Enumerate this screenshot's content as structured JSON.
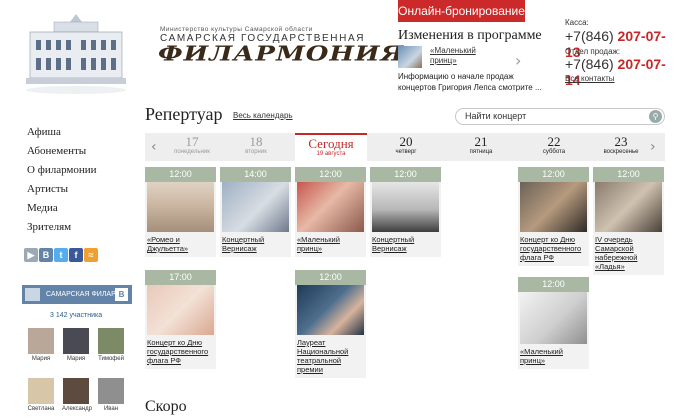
{
  "header": {
    "ministry": "Министерство культуры Самарской области",
    "org_line1": "САМАРСКАЯ ГОСУДАРСТВЕННАЯ",
    "org_line2": "ФИЛАРМОНИЯ",
    "booking_button": "Онлайн-бронирование",
    "changes_title": "Изменения в программе",
    "changes_link": "«Маленький принц»",
    "changes_text": "Информацию о начале продаж концертов Григория Лепса смотрите ...",
    "box_office_label": "Касса:",
    "box_office_code": "+7(846)",
    "box_office_number": "207-07-13",
    "sales_label": "Отдел продаж:",
    "sales_code": "+7(846)",
    "sales_number": "207-07-14",
    "all_contacts": "Все контакты"
  },
  "nav": {
    "items": [
      "Афиша",
      "Абонементы",
      "О филармонии",
      "Артисты",
      "Медиа",
      "Зрителям"
    ]
  },
  "vk": {
    "group_name": "САМАРСКАЯ ФИЛАР...",
    "vk_logo": "В",
    "members": "3 142 участника",
    "people": [
      "Мария",
      "Мария",
      "Тимофей",
      "Светлана",
      "Александр",
      "Иван"
    ]
  },
  "repertoire": {
    "title": "Репертуар",
    "all_calendar": "Весь календарь",
    "search_placeholder": "Найти концерт",
    "days": [
      {
        "d": "17",
        "w": "понедельник"
      },
      {
        "d": "18",
        "w": "вторник"
      },
      {
        "d": "Сегодня",
        "w": "19 августа"
      },
      {
        "d": "20",
        "w": "четверг"
      },
      {
        "d": "21",
        "w": "пятница"
      },
      {
        "d": "22",
        "w": "суббота"
      },
      {
        "d": "23",
        "w": "воскресенье"
      }
    ],
    "events": [
      {
        "time": "12:00",
        "title": "«Ромео и Джульетта»"
      },
      {
        "time": "14:00",
        "title": "Концертный Вернисаж"
      },
      {
        "time": "12:00",
        "title": "«Маленький принц»"
      },
      {
        "time": "12:00",
        "title": "Концертный Вернисаж"
      },
      {
        "time": "12:00",
        "title": "Концерт ко Дню государственного флага РФ"
      },
      {
        "time": "12:00",
        "title": "IV очередь Самарской набережной «Ладья»"
      },
      {
        "time": "17:00",
        "title": "Концерт ко Дню государственного флага РФ"
      },
      {
        "time": "12:00",
        "title": "Лауреат Национальной театральной премии"
      },
      {
        "time": "12:00",
        "title": "«Маленький принц»"
      }
    ]
  },
  "soon_title": "Скоро"
}
